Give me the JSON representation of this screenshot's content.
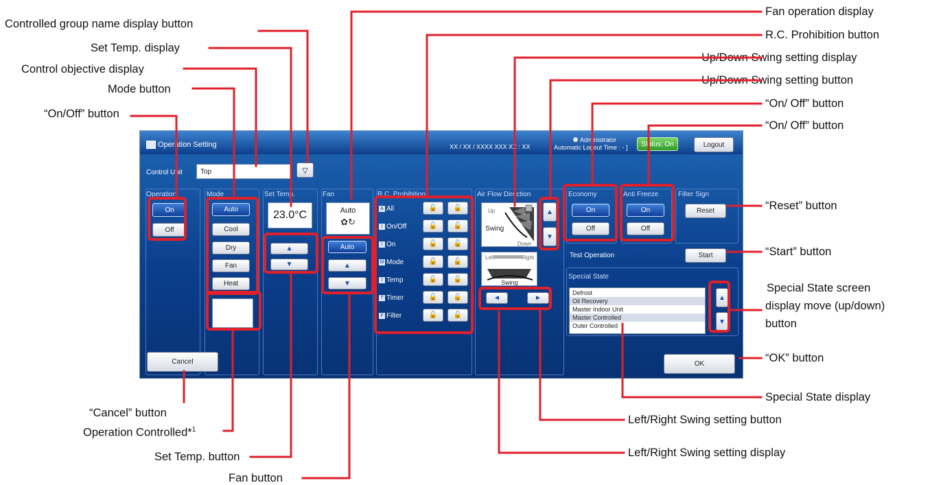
{
  "labels": {
    "controlled_group_name_btn": "Controlled group name display button",
    "set_temp_display": "Set Temp. display",
    "control_objective_display": "Control objective display",
    "mode_button": "Mode button",
    "on_off_button": "“On/Off” button",
    "fan_operation_display": "Fan operation display",
    "rc_prohibition_button": "R.C. Prohibition button",
    "updown_swing_display": "Up/Down Swing setting display",
    "updown_swing_button": "Up/Down Swing setting button",
    "on_off_1": "“On/ Off” button",
    "on_off_2": "“On/ Off” button",
    "reset_button": "“Reset” button",
    "start_button": "“Start” button",
    "special_state_move_1": "Special State screen",
    "special_state_move_2": "display move (up/down)",
    "special_state_move_3": "button",
    "ok_button": "“OK” button",
    "special_state_display": "Special State display",
    "lr_swing_button": "Left/Right Swing setting button",
    "lr_swing_display": "Left/Right Swing setting display",
    "cancel_button": "“Cancel” button",
    "operation_controlled": "Operation Controlled*",
    "operation_controlled_sup": "1",
    "set_temp_button": "Set Temp. button",
    "fan_button": "Fan button"
  },
  "screen": {
    "title": "Operation Setting",
    "datetime": "XX / XX / XXXX  XXX  XX : XX",
    "user": "Administrator",
    "auto_logout": "Automatic Logout Time : - ]",
    "status": "Status: On",
    "logout": "Logout",
    "control_unit_label": "Control Unit",
    "control_unit_value": "Top",
    "operation": {
      "head": "Operation",
      "on": "On",
      "off": "Off"
    },
    "mode": {
      "head": "Mode",
      "items": [
        "Auto",
        "Cool",
        "Dry",
        "Fan",
        "Heat"
      ]
    },
    "set_temp": {
      "head": "Set Temp.",
      "value": "23.0°C",
      "up": "▲",
      "down": "▼"
    },
    "fan": {
      "head": "Fan",
      "display": "Auto",
      "auto_btn": "Auto",
      "up": "▲",
      "down": "▼"
    },
    "rc": {
      "head": "R.C. Prohibition",
      "rows": [
        "All",
        "On/Off",
        "On",
        "Mode",
        "Temp",
        "Timer",
        "Filter"
      ],
      "icons": [
        "A",
        "I",
        "I",
        "M",
        "I",
        "T",
        "F"
      ]
    },
    "airflow": {
      "head": "Air Flow Direction",
      "up": "Up",
      "down": "Down",
      "swing": "Swing",
      "left": "Left",
      "right": "Right",
      "swing2": "Swing"
    },
    "economy": {
      "head": "Economy",
      "on": "On",
      "off": "Off"
    },
    "anti_freeze": {
      "head": "Anti Freeze",
      "on": "On",
      "off": "Off"
    },
    "filter_sign": {
      "head": "Filter Sign",
      "reset": "Reset"
    },
    "test_operation": {
      "label": "Test Operation",
      "start": "Start"
    },
    "special_state": {
      "head": "Special State",
      "items": [
        "Defrost",
        "Oil Recovery",
        "Master Indoor Unit",
        "Master Controlled",
        "Outer Controlled"
      ]
    },
    "cancel": "Cancel",
    "ok": "OK"
  },
  "colors": {
    "accent": "#e0202a",
    "screen_bg": "#0b3f8c",
    "selected": "#1f56b5"
  }
}
